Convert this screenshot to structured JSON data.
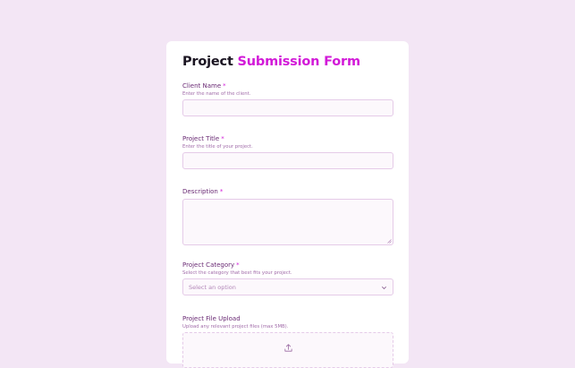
{
  "form": {
    "title_part1": "Project",
    "title_part2": "Submission Form",
    "required_mark": "*",
    "fields": {
      "client_name": {
        "label": "Client Name",
        "help": "Enter the name of the client.",
        "value": ""
      },
      "project_title": {
        "label": "Project Title",
        "help": "Enter the title of your project.",
        "value": ""
      },
      "description": {
        "label": "Description",
        "value": ""
      },
      "category": {
        "label": "Project Category",
        "help": "Select the category that best fits your project.",
        "selected": "Select an option"
      },
      "file_upload": {
        "label": "Project File Upload",
        "help": "Upload any relevant project files (max 5MB).",
        "icon": "upload-icon"
      }
    }
  },
  "colors": {
    "page_background": "#f3e6f5",
    "accent": "#d21ad8",
    "label": "#6a2a74",
    "input_border": "#e5cbe8"
  }
}
